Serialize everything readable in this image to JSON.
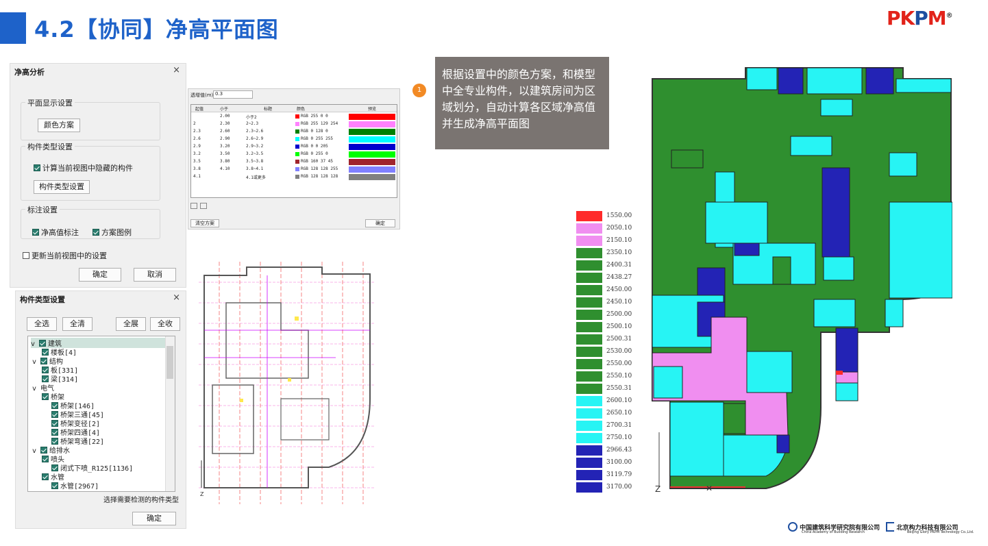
{
  "header": {
    "title": "4.2【协同】净高平面图",
    "logo_text_left": "PK",
    "logo_text_mid": "P",
    "logo_text_right": "M",
    "logo_reg": "®"
  },
  "dialog_analysis": {
    "title": "净高分析",
    "close": "×",
    "plane_group": "平面显示设置",
    "color_scheme_button": "颜色方案",
    "type_group": "构件类型设置",
    "hidden_check": "计算当前视图中隐藏的构件",
    "type_button": "构件类型设置",
    "label_group": "标注设置",
    "clear_height_label": "净高值标注",
    "scheme_legend": "方案图例",
    "update_check": "更新当前视图中的设置",
    "ok": "确定",
    "cancel": "取消"
  },
  "dialog_types": {
    "title": "构件类型设置",
    "close": "×",
    "select_all": "全选",
    "clear_all": "全清",
    "expand_all": "全展",
    "collapse_all": "全收",
    "hint": "选择需要检测的构件类型",
    "ok": "确定",
    "tree": [
      {
        "label": "建筑",
        "level": 0,
        "expander": "v"
      },
      {
        "label": "楼板[4]",
        "level": 1
      },
      {
        "label": "结构",
        "level": 0,
        "expander": "v"
      },
      {
        "label": "板[331]",
        "level": 1
      },
      {
        "label": "梁[314]",
        "level": 1
      },
      {
        "label": "电气",
        "level": 0,
        "expander": "v",
        "nocheck": true
      },
      {
        "label": "桥架",
        "level": 1
      },
      {
        "label": "桥架[146]",
        "level": 2
      },
      {
        "label": "桥架三通[45]",
        "level": 2
      },
      {
        "label": "桥架变径[2]",
        "level": 2
      },
      {
        "label": "桥架四通[4]",
        "level": 2
      },
      {
        "label": "桥架弯通[22]",
        "level": 2
      },
      {
        "label": "给排水",
        "level": 0,
        "expander": "v"
      },
      {
        "label": "喷头",
        "level": 1
      },
      {
        "label": "闭式下喷_R125[1136]",
        "level": 2
      },
      {
        "label": "水管",
        "level": 1
      },
      {
        "label": "水管[2967]",
        "level": 2
      }
    ]
  },
  "color_panel": {
    "threshold_label": "透增值(m)",
    "threshold_value": "0.3",
    "headers": [
      "起值",
      "小于",
      "标题",
      "颜色",
      "预览"
    ],
    "rows": [
      {
        "start": "",
        "lt": "2.00",
        "title": "小于2",
        "color": "RGB 255 0 0",
        "hex": "#ff0000"
      },
      {
        "start": "2",
        "lt": "2.30",
        "title": "2~2.3",
        "color": "RGB 255 129 254",
        "hex": "#ff81fe"
      },
      {
        "start": "2.3",
        "lt": "2.60",
        "title": "2.3~2.6",
        "color": "RGB 0 128 0",
        "hex": "#008000"
      },
      {
        "start": "2.6",
        "lt": "2.90",
        "title": "2.6~2.9",
        "color": "RGB 0 255 255",
        "hex": "#00ffff"
      },
      {
        "start": "2.9",
        "lt": "3.20",
        "title": "2.9~3.2",
        "color": "RGB 0 0 205",
        "hex": "#0000cd"
      },
      {
        "start": "3.2",
        "lt": "3.50",
        "title": "3.2~3.5",
        "color": "RGB 0 255 0",
        "hex": "#00ff00"
      },
      {
        "start": "3.5",
        "lt": "3.80",
        "title": "3.5~3.8",
        "color": "RGB 160 37 45",
        "hex": "#a0252d"
      },
      {
        "start": "3.8",
        "lt": "4.10",
        "title": "3.8~4.1",
        "color": "RGB 128 128 255",
        "hex": "#8080ff"
      },
      {
        "start": "4.1",
        "lt": "",
        "title": "4.1或更多",
        "color": "RGB 128 128 128",
        "hex": "#808080"
      }
    ],
    "clear_button": "清空方案",
    "ok": "确定"
  },
  "callout": {
    "num": "1",
    "text": "根据设置中的颜色方案，和模型中全专业构件，以建筑房间为区域划分，自动计算各区域净高值并生成净高平面图"
  },
  "legend": [
    {
      "value": "1550.00",
      "color": "#ff2a2a"
    },
    {
      "value": "2050.10",
      "color": "#f08ef0"
    },
    {
      "value": "2150.10",
      "color": "#f08ef0"
    },
    {
      "value": "2350.10",
      "color": "#2f8f2f"
    },
    {
      "value": "2400.31",
      "color": "#2f8f2f"
    },
    {
      "value": "2438.27",
      "color": "#2f8f2f"
    },
    {
      "value": "2450.00",
      "color": "#2f8f2f"
    },
    {
      "value": "2450.10",
      "color": "#2f8f2f"
    },
    {
      "value": "2500.00",
      "color": "#2f8f2f"
    },
    {
      "value": "2500.10",
      "color": "#2f8f2f"
    },
    {
      "value": "2500.31",
      "color": "#2f8f2f"
    },
    {
      "value": "2530.00",
      "color": "#2f8f2f"
    },
    {
      "value": "2550.00",
      "color": "#2f8f2f"
    },
    {
      "value": "2550.10",
      "color": "#2f8f2f"
    },
    {
      "value": "2550.31",
      "color": "#2f8f2f"
    },
    {
      "value": "2600.10",
      "color": "#27f4f4"
    },
    {
      "value": "2650.10",
      "color": "#27f4f4"
    },
    {
      "value": "2700.31",
      "color": "#27f4f4"
    },
    {
      "value": "2750.10",
      "color": "#27f4f4"
    },
    {
      "value": "2966.43",
      "color": "#2323b5"
    },
    {
      "value": "3100.00",
      "color": "#2323b5"
    },
    {
      "value": "3119.79",
      "color": "#2323b5"
    },
    {
      "value": "3170.00",
      "color": "#2323b5"
    }
  ],
  "footer": {
    "org1": "中国建筑科学研究院有限公司",
    "org1_en": "China Academy of Building Research",
    "org2": "北京构力科技有限公司",
    "org2_en": "Beijing Glory PKPM Technology Co.,Ltd."
  }
}
